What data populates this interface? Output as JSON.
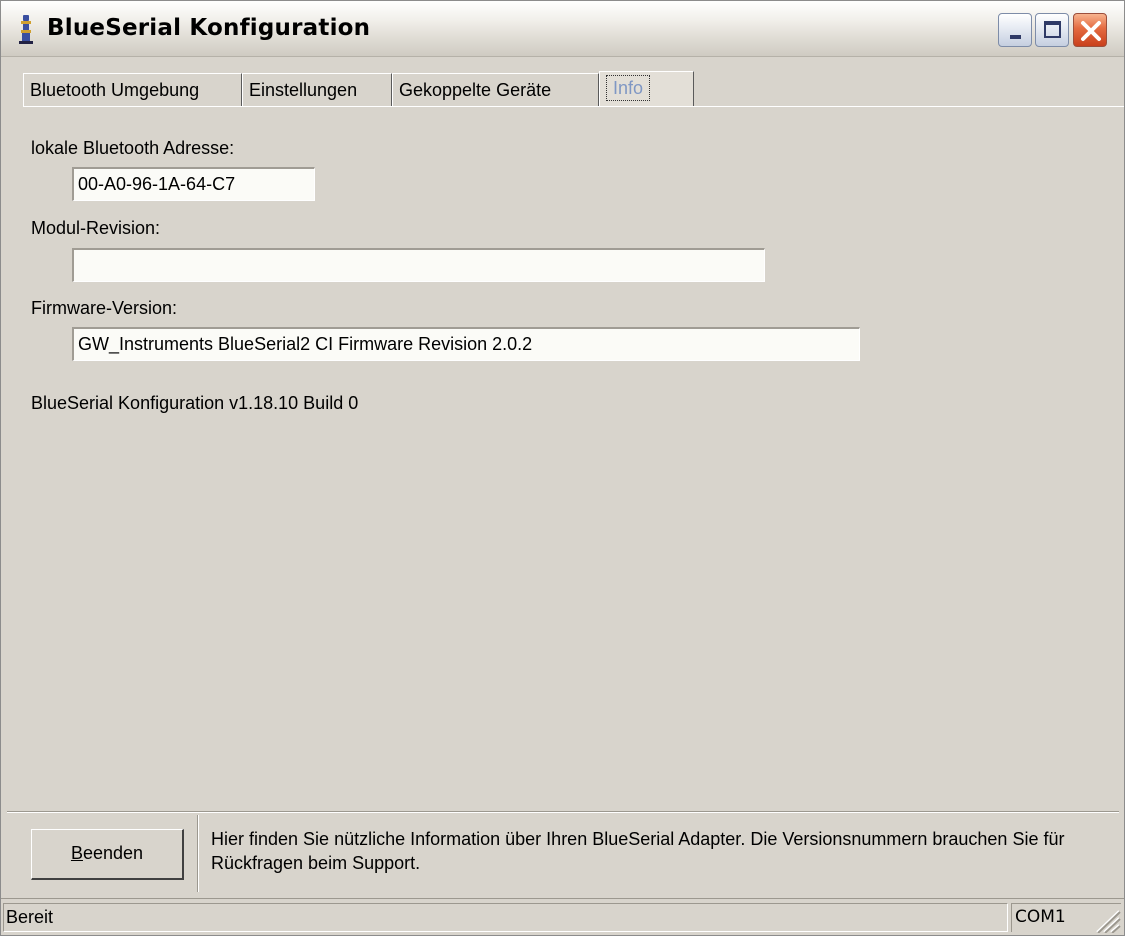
{
  "window": {
    "title": "BlueSerial Konfiguration"
  },
  "tabs": [
    {
      "label": "Bluetooth Umgebung",
      "active": false
    },
    {
      "label": "Einstellungen",
      "active": false
    },
    {
      "label": "Gekoppelte Geräte",
      "active": false
    },
    {
      "label": "Info",
      "active": true
    }
  ],
  "info": {
    "address_label": "lokale Bluetooth Adresse:",
    "address_value": "00-A0-96-1A-64-C7",
    "module_label": "Modul-Revision:",
    "module_value": "",
    "firmware_label": "Firmware-Version:",
    "firmware_value": "GW_Instruments BlueSerial2 CI Firmware Revision 2.0.2",
    "version_text": "BlueSerial Konfiguration v1.18.10 Build 0"
  },
  "footer": {
    "exit_button_prefix": "B",
    "exit_button_rest": "eenden",
    "hint_text": "Hier finden Sie nützliche Information über Ihren BlueSerial Adapter. Die Versionsnummern brauchen Sie für Rückfragen beim Support."
  },
  "statusbar": {
    "status": "Bereit",
    "port": "COM1"
  },
  "icons": {
    "app": "bluetooth-tower-icon",
    "minimize": "minimize-icon",
    "maximize": "maximize-icon",
    "close": "close-icon",
    "grip": "resize-grip-icon"
  },
  "colors": {
    "window_bg": "#d8d4cc",
    "close_button": "#e46a40",
    "active_tab_text": "#7f97c4"
  }
}
